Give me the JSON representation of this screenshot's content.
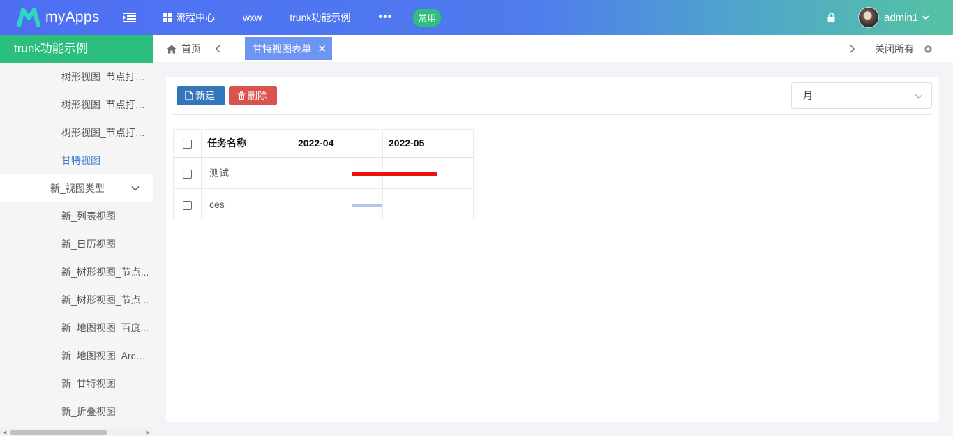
{
  "header": {
    "app_name": "myApps",
    "nav": [
      {
        "label": "流程中心",
        "icon": "grid-icon"
      },
      {
        "label": "wxw"
      },
      {
        "label": "trunk功能示例"
      }
    ],
    "more_label": "•••",
    "badge_label": "常用",
    "username": "admin1"
  },
  "sidebar": {
    "title": "trunk功能示例",
    "items_top": [
      {
        "label": "树形视图_节点打开..."
      },
      {
        "label": "树形视图_节点打开..."
      },
      {
        "label": "树形视图_节点打开..."
      },
      {
        "label": "甘特视图",
        "active": true
      }
    ],
    "group": {
      "label": "新_视图类型",
      "expanded": true
    },
    "items_group": [
      {
        "label": "新_列表视图"
      },
      {
        "label": "新_日历视图"
      },
      {
        "label": "新_树形视图_节点..."
      },
      {
        "label": "新_树形视图_节点..."
      },
      {
        "label": "新_地图视图_百度..."
      },
      {
        "label": "新_地图视图_ArcGI..."
      },
      {
        "label": "新_甘特视图"
      },
      {
        "label": "新_折叠视图"
      }
    ]
  },
  "tabs": {
    "home_label": "首页",
    "active_tab_label": "甘特视图表单",
    "close_all_label": "关闭所有"
  },
  "toolbar": {
    "new_label": "新建",
    "delete_label": "删除",
    "scale_select_value": "月"
  },
  "gantt": {
    "columns": [
      "任务名称",
      "2022-04",
      "2022-05"
    ],
    "rows": [
      {
        "name": "测试",
        "bar_color": "#ee1111",
        "bar_start_fraction": 0.33,
        "bar_end_fraction": 0.8
      },
      {
        "name": "ces",
        "bar_color": "#b3c6e6",
        "bar_start_fraction": 0.33,
        "bar_end_fraction": 0.5
      }
    ]
  },
  "colors": {
    "header_gradient_start": "#4e6ef2",
    "header_gradient_end": "#56c3a2",
    "sidebar_title_bg": "#2cbe7d",
    "active_tab_bg": "#6f95f2",
    "new_button_bg": "#3476bb",
    "delete_button_bg": "#d9534f",
    "badge_bg": "#2fbe7c",
    "sidebar_active_text": "#3a7bd5"
  }
}
